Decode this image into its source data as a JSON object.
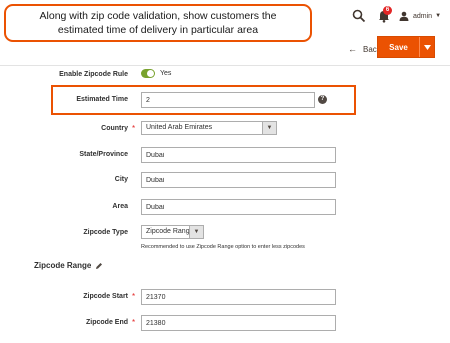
{
  "callout": {
    "text": "Along with zip code validation, show customers the estimated time of delivery in particular area"
  },
  "header": {
    "notification_count": "6",
    "user_name": "admin",
    "back_label": "Back",
    "save_label": "Save"
  },
  "form": {
    "enable_zipcode_rule": {
      "label": "Enable Zipcode Rule",
      "value_label": "Yes"
    },
    "estimated_time": {
      "label": "Estimated Time",
      "value": "2"
    },
    "country": {
      "label": "Country",
      "value": "United Arab Emirates"
    },
    "state_province": {
      "label": "State/Province",
      "value": "Dubai"
    },
    "city": {
      "label": "City",
      "value": "Dubai"
    },
    "area": {
      "label": "Area",
      "value": "Dubai"
    },
    "zipcode_type": {
      "label": "Zipcode Type",
      "value": "Zipcode Range",
      "note": "Recommended to use Zipcode Range option to enter less zipcodes"
    },
    "zipcode_range_title": "Zipcode Range",
    "zipcode_start": {
      "label": "Zipcode Start",
      "value": "21370"
    },
    "zipcode_end": {
      "label": "Zipcode End",
      "value": "21380"
    }
  },
  "colors": {
    "accent": "#eb5202",
    "toggle_on": "#79a22e",
    "required": "#e22626"
  }
}
